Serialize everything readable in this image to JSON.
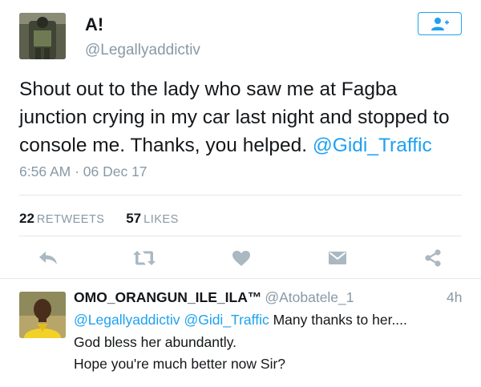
{
  "tweet": {
    "author_name": "A!",
    "author_handle": "@Legallyaddictiv",
    "text_main": "Shout out to the lady who saw me at Fagba junction crying in my car last night and stopped to console me. Thanks, you helped.",
    "text_mention": "@Gidi_Traffic",
    "timestamp": "6:56 AM · 06 Dec 17",
    "retweets_count": "22",
    "retweets_label": "RETWEETS",
    "likes_count": "57",
    "likes_label": "LIKES"
  },
  "icons": {
    "follow": "add-user-icon",
    "reply": "reply-icon",
    "retweet": "retweet-icon",
    "like": "heart-icon",
    "dm": "envelope-icon",
    "share": "share-icon"
  },
  "reply": {
    "author_name": "OMO_ORANGUN_ILE_ILA™",
    "author_handle": "@Atobatele_1",
    "time": "4h",
    "mention_1": "@Legallyaddictiv",
    "mention_2": "@Gidi_Traffic",
    "line1_text": "Many thanks to her....",
    "line2": "God bless her abundantly.",
    "line3": "Hope you're much better now Sir?"
  },
  "colors": {
    "accent": "#1da1f2",
    "muted": "#8899a6",
    "icon": "#aab8c2"
  }
}
